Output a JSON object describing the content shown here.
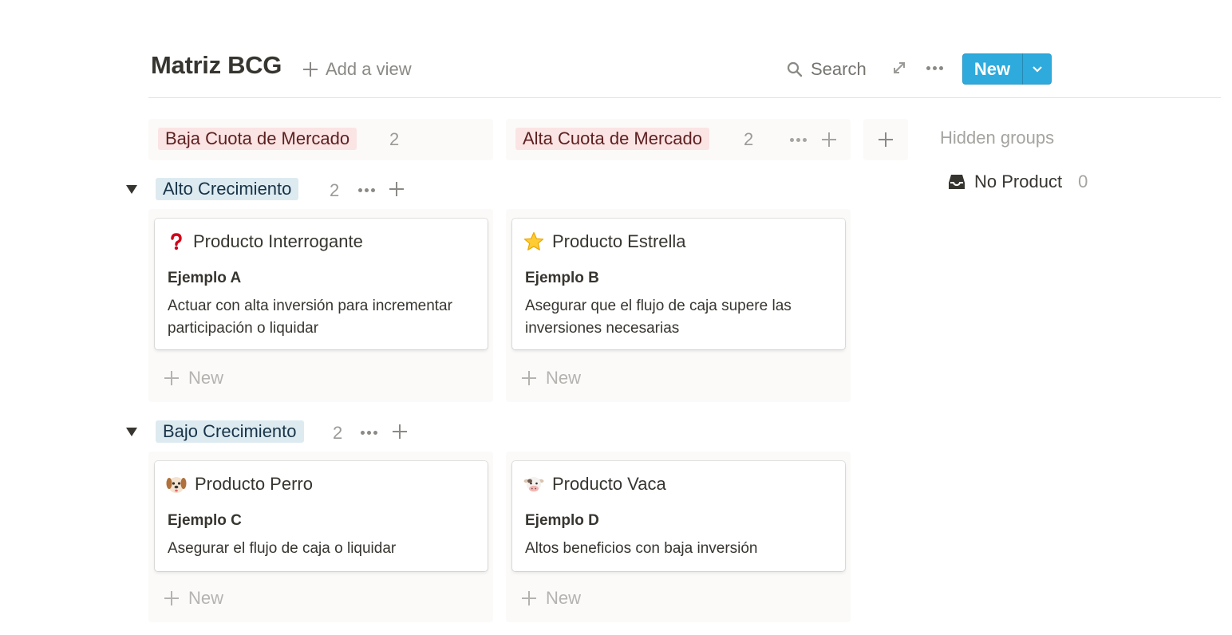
{
  "header": {
    "title": "Matriz BCG",
    "add_view_label": "Add a view",
    "search_label": "Search",
    "new_button_label": "New",
    "accent_color": "#2eaadc"
  },
  "columns": [
    {
      "label": "Baja Cuota de Mercado",
      "count": "2",
      "color": "#fbe4e4"
    },
    {
      "label": "Alta Cuota de Mercado",
      "count": "2",
      "color": "#fbe4e4"
    }
  ],
  "hidden_groups": {
    "title": "Hidden groups",
    "items": [
      {
        "label": "No Product",
        "count": "0"
      }
    ]
  },
  "rows": [
    {
      "label": "Alto Crecimiento",
      "count": "2",
      "cards": [
        {
          "icon": "question-mark-icon",
          "title": "Producto Interrogante",
          "subtitle": "Ejemplo A",
          "description": "Actuar con alta inversión para incrementar participación o liquidar"
        },
        {
          "icon": "star-icon",
          "title": "Producto Estrella",
          "subtitle": "Ejemplo B",
          "description": "Asegurar que el flujo de caja supere las inversiones necesarias"
        }
      ],
      "new_label": "New"
    },
    {
      "label": "Bajo Crecimiento",
      "count": "2",
      "cards": [
        {
          "icon": "dog-face-icon",
          "title": "Producto Perro",
          "subtitle": "Ejemplo C",
          "description": "Asegurar el flujo de caja o liquidar"
        },
        {
          "icon": "cow-face-icon",
          "title": "Producto Vaca",
          "subtitle": "Ejemplo D",
          "description": "Altos beneficios con baja inversión"
        }
      ],
      "new_label": "New"
    }
  ]
}
